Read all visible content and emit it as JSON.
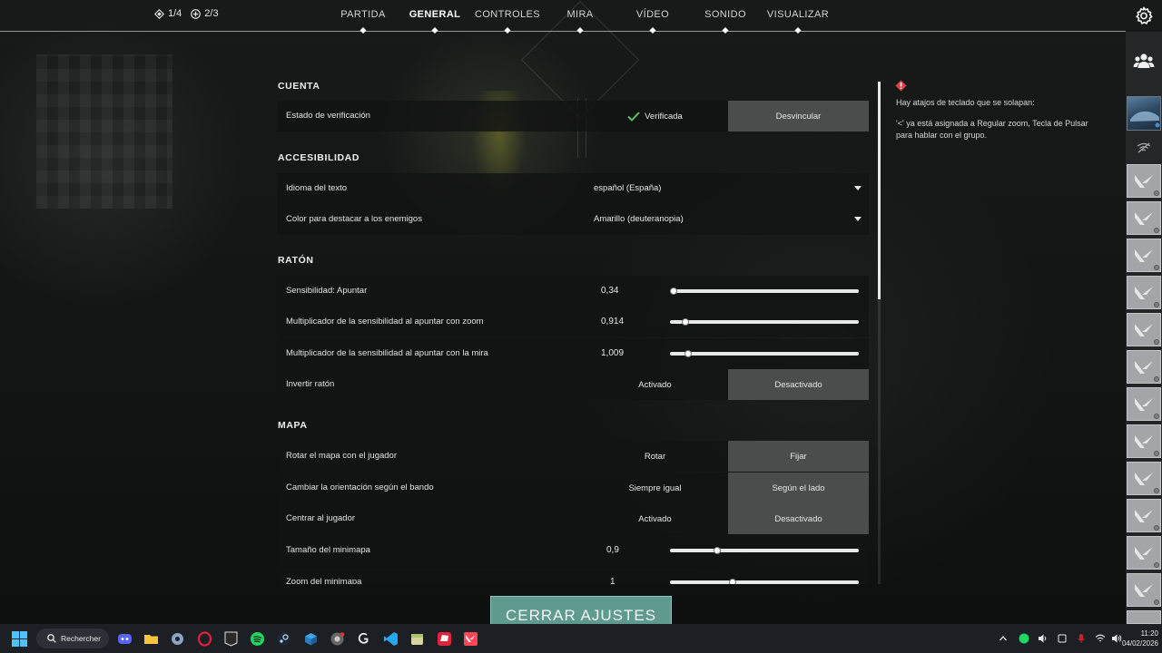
{
  "topbar": {
    "counter_left": "1/4",
    "counter_right": "2/3",
    "tabs": [
      {
        "label": "PARTIDA"
      },
      {
        "label": "GENERAL",
        "active": true
      },
      {
        "label": "CONTROLES"
      },
      {
        "label": "MIRA"
      },
      {
        "label": "VÍDEO"
      },
      {
        "label": "SONIDO"
      },
      {
        "label": "VISUALIZAR"
      }
    ],
    "settings_icon": "gear-icon"
  },
  "sections": {
    "cuenta": {
      "title": "CUENTA",
      "verification": {
        "label": "Estado de verificación",
        "status": "Verificada",
        "action": "Desvincular"
      }
    },
    "accesibilidad": {
      "title": "ACCESIBILIDAD",
      "language": {
        "label": "Idioma del texto",
        "value": "español (España)"
      },
      "enemy_color": {
        "label": "Color para destacar a los enemigos",
        "value": "Amarillo (deuteranopia)"
      }
    },
    "raton": {
      "title": "RATÓN",
      "sensitivity": {
        "label": "Sensibilidad: Apuntar",
        "value": "0,34",
        "fraction": 0.02
      },
      "zoom_multiplier": {
        "label": "Multiplicador de la sensibilidad al apuntar con zoom",
        "value": "0,914",
        "fraction": 0.08
      },
      "scope_multiplier": {
        "label": "Multiplicador de la sensibilidad al apuntar con la mira",
        "value": "1,009",
        "fraction": 0.095
      },
      "invert": {
        "label": "Invertir ratón",
        "option_a": "Activado",
        "option_b": "Desactivado",
        "selected": "Desactivado"
      }
    },
    "mapa": {
      "title": "MAPA",
      "rotate": {
        "label": "Rotar el mapa con el jugador",
        "option_a": "Rotar",
        "option_b": "Fijar",
        "selected": "Fijar"
      },
      "orientation": {
        "label": "Cambiar la orientación según el bando",
        "option_a": "Siempre igual",
        "option_b": "Según el lado",
        "selected": "Según el lado"
      },
      "center": {
        "label": "Centrar al jugador",
        "option_a": "Activado",
        "option_b": "Desactivado",
        "selected": "Desactivado"
      },
      "minimap_size": {
        "label": "Tamaño del minimapa",
        "value": "0,9",
        "fraction": 0.25
      },
      "minimap_zoom": {
        "label": "Zoom del minimapa",
        "value": "1",
        "fraction": 0.33
      }
    }
  },
  "warning": {
    "title": "Hay atajos de teclado que se solapan:",
    "detail": "'<' ya está asignada a Regular zoom, Tecla de Pulsar para hablar con el grupo."
  },
  "close_button": "CERRAR AJUSTES",
  "taskbar": {
    "search_label": "Rechercher",
    "time": "11:20",
    "date": "04/02/2026"
  },
  "colors": {
    "accent": "#5e9a8e",
    "verified_check": "#5fbf6a",
    "warning": "#e0404a"
  }
}
